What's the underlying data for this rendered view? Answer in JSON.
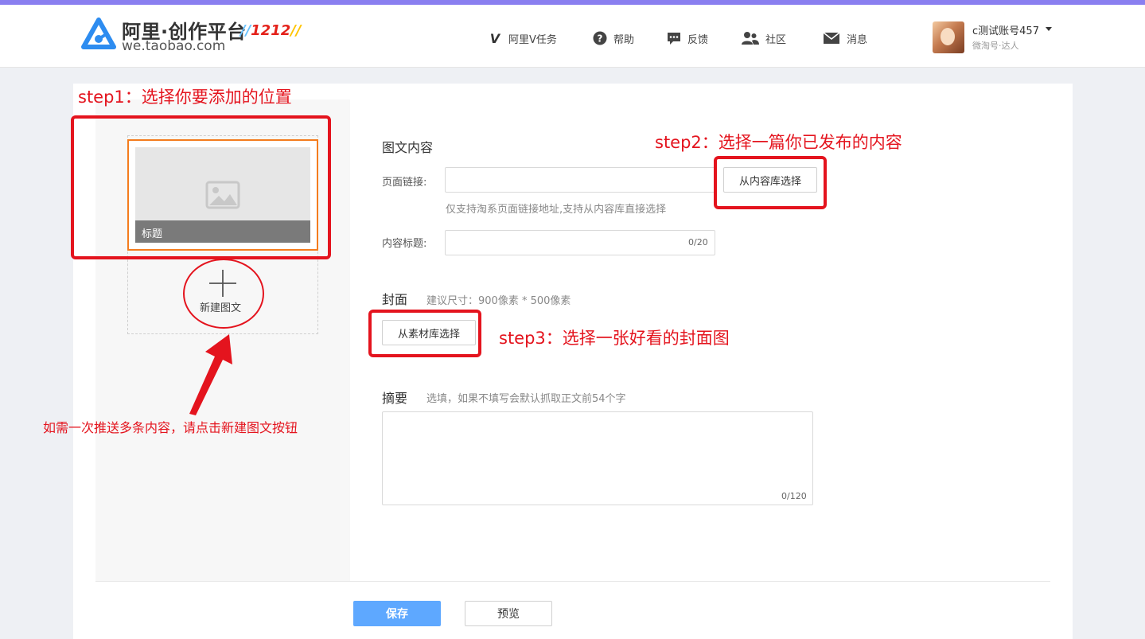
{
  "header": {
    "logo_cn": "阿里·创作平台",
    "logo_en": "we.taobao.com",
    "logo_badge": "1212",
    "nav": [
      {
        "label": "阿里V任务",
        "icon": "v-task-icon"
      },
      {
        "label": "帮助",
        "icon": "help-icon"
      },
      {
        "label": "反馈",
        "icon": "feedback-icon"
      },
      {
        "label": "社区",
        "icon": "community-icon"
      },
      {
        "label": "消息",
        "icon": "message-icon"
      }
    ],
    "account": {
      "name": "c测试账号457",
      "subtitle": "微淘号·达人"
    }
  },
  "sidebar": {
    "item_title": "标题",
    "new_item_label": "新建图文"
  },
  "form": {
    "content_section_title": "图文内容",
    "link_label": "页面链接:",
    "link_value": "",
    "link_select_button": "从内容库选择",
    "link_hint": "仅支持淘系页面链接地址,支持从内容库直接选择",
    "title_label": "内容标题:",
    "title_value": "",
    "title_counter": "0/20",
    "cover_section_title": "封面",
    "cover_hint": "建议尺寸：900像素 * 500像素",
    "cover_select_button": "从素材库选择",
    "summary_section_title": "摘要",
    "summary_hint": "选填，如果不填写会默认抓取正文前54个字",
    "summary_value": "",
    "summary_counter": "0/120"
  },
  "footer": {
    "save_button": "保存",
    "preview_button": "预览"
  },
  "annotations": {
    "step1": "step1：选择你要添加的位置",
    "step2": "step2：选择一篇你已发布的内容",
    "step3": "step3：选择一张好看的封面图",
    "note": "如需一次推送多条内容，请点击新建图文按钮"
  },
  "colors": {
    "accent_bar": "#8a7ff0",
    "primary_button": "#5ea8ff",
    "selected_border": "#f47c1e",
    "annotation_red": "#e4141e"
  }
}
